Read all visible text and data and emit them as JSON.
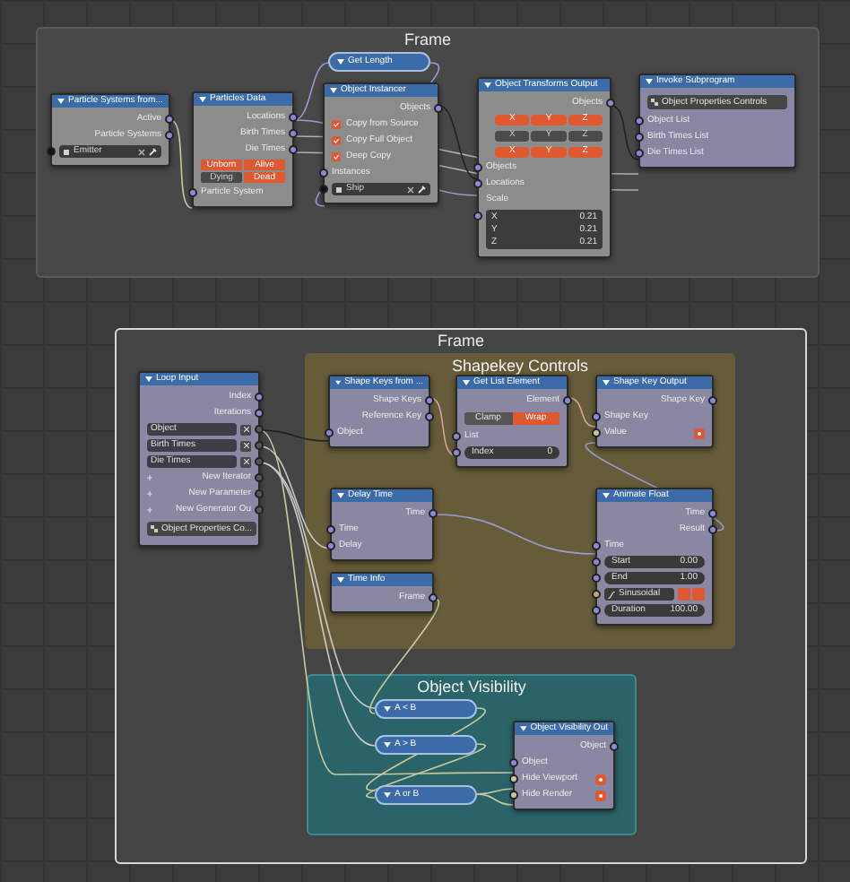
{
  "frames": [
    {
      "label": "Frame",
      "color": "#484848"
    },
    {
      "label": "Frame",
      "color": "#444444"
    },
    {
      "label": "Shapekey Controls",
      "color": "#675c3a"
    },
    {
      "label": "Object Visibility",
      "color": "#2b6468"
    }
  ],
  "nodes": [
    {
      "kind": "node",
      "title": "Particle Systems from...",
      "color": "#8c8c8c",
      "rows": [
        {
          "kind": "output",
          "label": "Active"
        },
        {
          "kind": "output",
          "label": "Particle Systems"
        },
        {
          "kind": "object_field",
          "value": "Emitter"
        }
      ]
    },
    {
      "kind": "node",
      "title": "Particles Data",
      "color": "#8c8c8c",
      "rows": [
        {
          "kind": "output",
          "label": "Locations"
        },
        {
          "kind": "output",
          "label": "Birth Times"
        },
        {
          "kind": "output",
          "label": "Die Times"
        },
        {
          "kind": "toggle_grid",
          "options": [
            {
              "label": "Unborn",
              "on": true
            },
            {
              "label": "Alive",
              "on": true
            },
            {
              "label": "Dying",
              "on": false
            },
            {
              "label": "Dead",
              "on": true
            }
          ]
        },
        {
          "kind": "input",
          "label": "Particle System"
        }
      ]
    },
    {
      "kind": "collapsed",
      "title": "Get Length"
    },
    {
      "kind": "node",
      "title": "Object Instancer",
      "color": "#8c8c8c",
      "rows": [
        {
          "kind": "output",
          "label": "Objects"
        },
        {
          "kind": "checkbox",
          "label": "Copy from Source",
          "checked": true
        },
        {
          "kind": "checkbox",
          "label": "Copy Full Object",
          "checked": true
        },
        {
          "kind": "checkbox",
          "label": "Deep Copy",
          "checked": true
        },
        {
          "kind": "input",
          "label": "Instances"
        },
        {
          "kind": "object_field",
          "value": "Ship"
        }
      ]
    },
    {
      "kind": "node",
      "title": "Object Transforms Output",
      "color": "#8c8c8c",
      "rows": [
        {
          "kind": "output",
          "label": "Objects"
        },
        {
          "kind": "xyz",
          "on": true,
          "axes": [
            "X",
            "Y",
            "Z"
          ]
        },
        {
          "kind": "xyz",
          "on": false,
          "axes": [
            "X",
            "Y",
            "Z"
          ]
        },
        {
          "kind": "xyz",
          "on": true,
          "axes": [
            "X",
            "Y",
            "Z"
          ]
        },
        {
          "kind": "input",
          "label": "Objects"
        },
        {
          "kind": "input",
          "label": "Locations"
        },
        {
          "kind": "label",
          "label": "Scale"
        },
        {
          "kind": "vector",
          "components": [
            {
              "label": "X",
              "value": "0.21"
            },
            {
              "label": "Y",
              "value": "0.21"
            },
            {
              "label": "Z",
              "value": "0.21"
            }
          ]
        }
      ]
    },
    {
      "kind": "node",
      "title": "Invoke Subprogram",
      "color": "#8985a3",
      "rows": [
        {
          "kind": "dropdown",
          "value": "Object Properties Controls"
        },
        {
          "kind": "input",
          "label": "Object List"
        },
        {
          "kind": "input",
          "label": "Birth Times List"
        },
        {
          "kind": "input",
          "label": "Die Times List"
        }
      ]
    },
    {
      "kind": "node",
      "title": "Loop Input",
      "color": "#8a87a2",
      "rows": [
        {
          "kind": "output",
          "label": "Index"
        },
        {
          "kind": "output",
          "label": "Iterations"
        },
        {
          "kind": "list_item",
          "label": "Object"
        },
        {
          "kind": "list_item",
          "label": "Birth Times"
        },
        {
          "kind": "list_item",
          "label": "Die Times"
        },
        {
          "kind": "add",
          "label": "New Iterator"
        },
        {
          "kind": "add",
          "label": "New Parameter"
        },
        {
          "kind": "add",
          "label": "New Generator Ou"
        },
        {
          "kind": "dropdown",
          "value": "Object Properties Co..."
        }
      ]
    },
    {
      "kind": "node",
      "title": "Shape Keys from ...",
      "color": "#8a87a2",
      "rows": [
        {
          "kind": "output",
          "label": "Shape Keys"
        },
        {
          "kind": "output",
          "label": "Reference Key"
        },
        {
          "kind": "input",
          "label": "Object"
        }
      ]
    },
    {
      "kind": "node",
      "title": "Get List Element",
      "color": "#8a87a2",
      "rows": [
        {
          "kind": "output",
          "label": "Element"
        },
        {
          "kind": "segmented",
          "options": [
            {
              "label": "Clamp",
              "selected": false
            },
            {
              "label": "Wrap",
              "selected": true
            }
          ]
        },
        {
          "kind": "input",
          "label": "List"
        },
        {
          "kind": "number",
          "label": "Index",
          "value": "0"
        }
      ]
    },
    {
      "kind": "node",
      "title": "Shape Key Output",
      "color": "#8a87a2",
      "rows": [
        {
          "kind": "output",
          "label": "Shape Key"
        },
        {
          "kind": "input",
          "label": "Shape Key"
        },
        {
          "kind": "toggle_input",
          "label": "Value",
          "on": true
        }
      ]
    },
    {
      "kind": "node",
      "title": "Delay Time",
      "color": "#8a87a2",
      "rows": [
        {
          "kind": "output",
          "label": "Time"
        },
        {
          "kind": "input",
          "label": "Time"
        },
        {
          "kind": "input",
          "label": "Delay"
        }
      ]
    },
    {
      "kind": "node",
      "title": "Time Info",
      "color": "#8a87a2",
      "rows": [
        {
          "kind": "output",
          "label": "Frame"
        }
      ]
    },
    {
      "kind": "node",
      "title": "Animate Float",
      "color": "#8a87a2",
      "rows": [
        {
          "kind": "output",
          "label": "Time"
        },
        {
          "kind": "output",
          "label": "Result"
        },
        {
          "kind": "input",
          "label": "Time"
        },
        {
          "kind": "number",
          "label": "Start",
          "value": "0.00"
        },
        {
          "kind": "number",
          "label": "End",
          "value": "1.00"
        },
        {
          "kind": "interpolation",
          "value": "Sinusoidal",
          "toggles": [
            {
              "on": true
            },
            {
              "on": true
            }
          ]
        },
        {
          "kind": "number",
          "label": "Duration",
          "value": "100.00"
        }
      ]
    },
    {
      "kind": "collapsed",
      "title": "A < B"
    },
    {
      "kind": "collapsed",
      "title": "A > B"
    },
    {
      "kind": "collapsed",
      "title": "A or B"
    },
    {
      "kind": "node",
      "title": "Object Visibility Out",
      "color": "#8a87a2",
      "rows": [
        {
          "kind": "output",
          "label": "Object"
        },
        {
          "kind": "input",
          "label": "Object"
        },
        {
          "kind": "toggle_input",
          "label": "Hide Viewport",
          "on": true
        },
        {
          "kind": "toggle_input",
          "label": "Hide Render",
          "on": true
        }
      ]
    }
  ]
}
